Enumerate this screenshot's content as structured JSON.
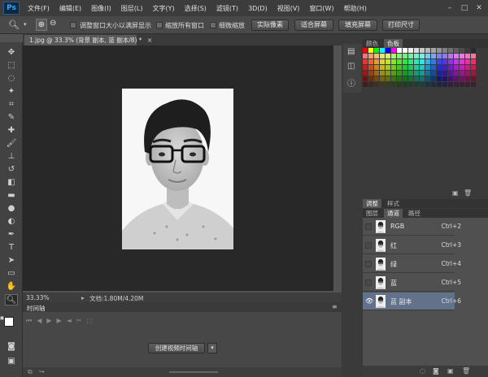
{
  "app": {
    "logo": "Ps"
  },
  "menu": [
    "文件(F)",
    "编辑(E)",
    "图像(I)",
    "图层(L)",
    "文字(Y)",
    "选择(S)",
    "滤镜(T)",
    "3D(D)",
    "视图(V)",
    "窗口(W)",
    "帮助(H)"
  ],
  "window_controls": {
    "minimize": "–",
    "maximize": "□",
    "close": "✕"
  },
  "options": {
    "resize_window": "调整窗口大小以满屏显示",
    "zoom_all": "缩放所有窗口",
    "scrubby_zoom": "细微缩放",
    "actual_pixels": "实际像素",
    "fit_screen": "适合屏幕",
    "fill_screen": "填充屏幕",
    "print_size": "打印尺寸"
  },
  "document": {
    "tab_title": "1.jpg @ 33.3% (背景 副本, 蓝 副本/8) *",
    "close": "×",
    "zoom": "33.33%",
    "doc_info": "文档:1.80M/4.20M"
  },
  "timeline": {
    "title": "时间轴",
    "create_button": "创建视频时间轴"
  },
  "panels": {
    "swatch_tabs": [
      "颜色",
      "色板"
    ],
    "adjust_tabs": [
      "调整",
      "样式"
    ],
    "layer_tabs": [
      "图层",
      "通道",
      "路径"
    ]
  },
  "channels": [
    {
      "name": "RGB",
      "shortcut": "Ctrl+2",
      "selected": false
    },
    {
      "name": "红",
      "shortcut": "Ctrl+3",
      "selected": false
    },
    {
      "name": "绿",
      "shortcut": "Ctrl+4",
      "selected": false
    },
    {
      "name": "蓝",
      "shortcut": "Ctrl+5",
      "selected": false
    },
    {
      "name": "蓝 副本",
      "shortcut": "Ctrl+6",
      "selected": true
    }
  ],
  "colors": {
    "selected_row": "#62728a",
    "ps_accent": "#31a8ff"
  }
}
